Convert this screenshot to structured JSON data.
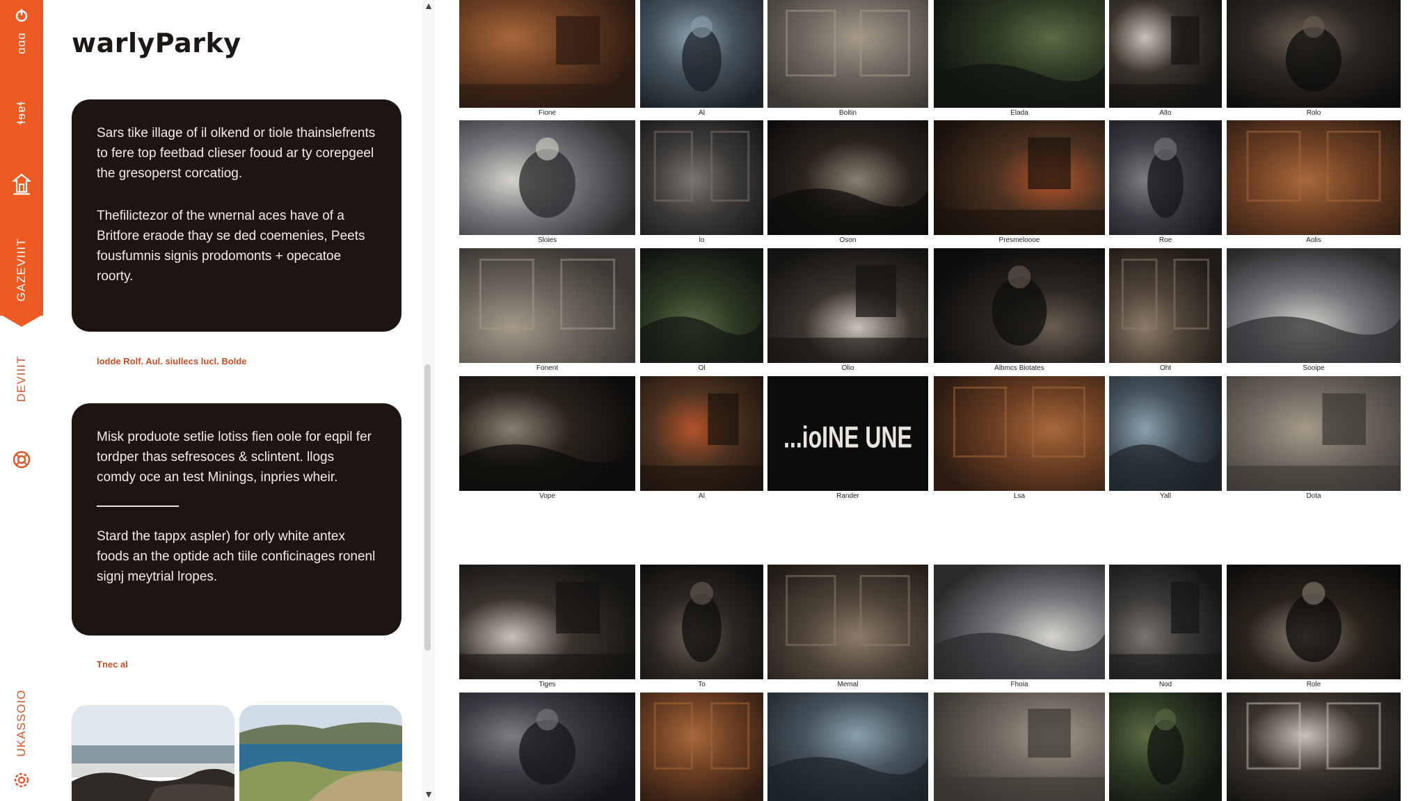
{
  "rail": {
    "top_items": [
      "ɑɑɑ",
      "ɬɘɐɬ",
      "GAZEVIIIT"
    ],
    "bottom_items": [
      "DEVIIIT",
      "UKASSOIO"
    ],
    "icons": [
      "power-icon",
      "temple-icon",
      "lifebuoy-icon",
      "gear-icon"
    ]
  },
  "sidebar": {
    "brand": "warlyParky",
    "card1": {
      "para1": "Sars tike illage of il olkend or tiole thainslefrents to fere top feetbad clieser fooud ar ty corepgeel the gresoperst corcatiog.",
      "para2": "Thefilictezor of the wnernal aces have of a Britfore eraode thay se ded coemenies, Peets fousfumnis signis prodomonts + opecatoe roorty."
    },
    "caption1": "lodde Rolf. Aul. siullecs lucl. Bolde",
    "card2": {
      "para1": "Misk produote setlie lotiss fien oole for eqpil fer tordper thas sefresoces & sclintent. llogs comdy oce an test Minings, inpries wheir.",
      "para2": "Stard the tappx aspler) for orly white antex foods an the optide ach tiile conficinages ronenl signj meytrial lropes."
    },
    "caption2": "Tnec al"
  },
  "scrollbar": {
    "up": "▲",
    "down": "▼"
  },
  "gallery": {
    "rows": [
      [
        "Fione",
        "Al",
        "Boltin",
        "Elada",
        "Alto",
        "Rolo"
      ],
      [
        "Sloies",
        "lo",
        "Oson",
        "Presmeloooe",
        "Roe",
        "Aolis"
      ],
      [
        "Fonent",
        "Ol",
        "Olio",
        "Albmcs Biotates",
        "Oht",
        "Sooipe"
      ],
      [
        "Vope",
        "Al",
        "Rander",
        "Lsa",
        "Yall",
        "Dota"
      ],
      [
        "Tiges",
        "To",
        "Memal",
        "Fhoia",
        "Nod",
        "Role"
      ],
      [
        "",
        "",
        "",
        "",
        "",
        ""
      ]
    ],
    "poster_text": "...ioINE UNE"
  },
  "colors": {
    "accent": "#ee5a24",
    "card": "#1c1512",
    "caption": "#c4502a"
  }
}
